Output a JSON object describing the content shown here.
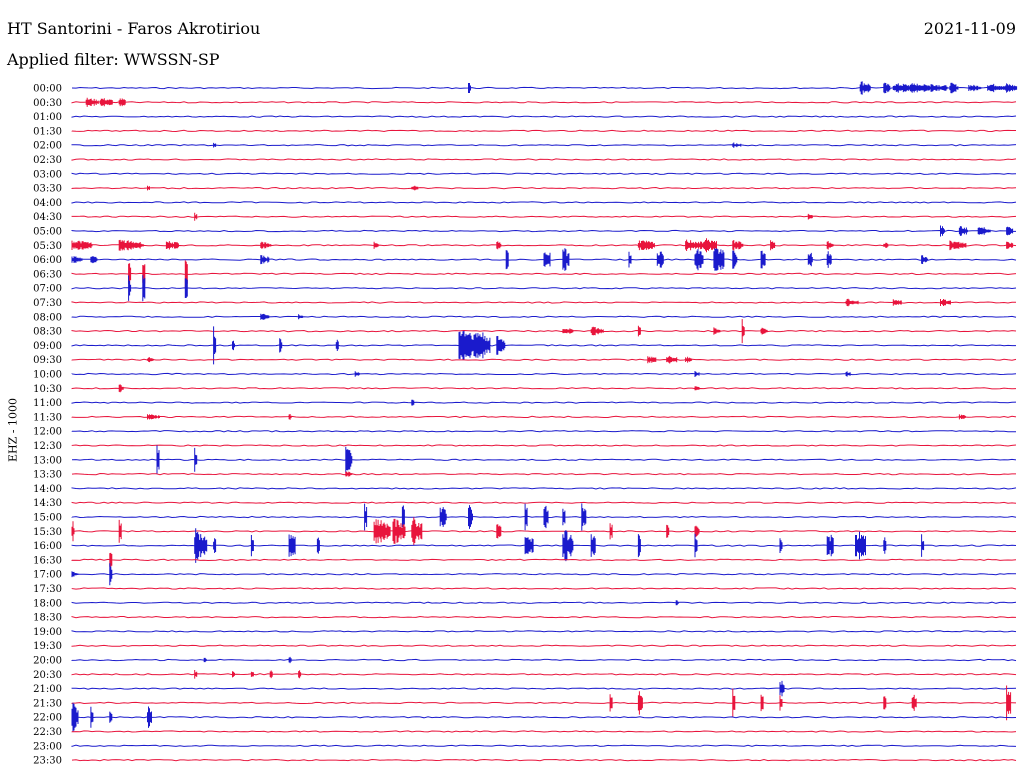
{
  "header": {
    "station": "HT Santorini - Faros Akrotiriou",
    "date": "2021-11-09",
    "filter": "Applied filter: WWSSN-SP",
    "channel": "EHZ - 1000"
  },
  "colors": {
    "blue": "#1a1acc",
    "red": "#e8143c"
  },
  "chart_data": {
    "type": "line",
    "title": "HT Santorini - Faros Akrotiriou",
    "date": "2021-11-09",
    "filter": "WWSSN-SP",
    "channel": "EHZ - 1000",
    "row_labels": [
      "00:00",
      "00:30",
      "01:00",
      "01:30",
      "02:00",
      "02:30",
      "03:00",
      "03:30",
      "04:00",
      "04:30",
      "05:00",
      "05:30",
      "06:00",
      "06:30",
      "07:00",
      "07:30",
      "08:00",
      "08:30",
      "09:00",
      "09:30",
      "10:00",
      "10:30",
      "11:00",
      "11:30",
      "12:00",
      "12:30",
      "13:00",
      "13:30",
      "14:00",
      "14:30",
      "15:00",
      "15:30",
      "16:00",
      "16:30",
      "17:00",
      "17:30",
      "18:00",
      "18:30",
      "19:00",
      "19:30",
      "20:00",
      "20:30",
      "21:00",
      "21:30",
      "22:00",
      "22:30",
      "23:00",
      "23:30"
    ],
    "row_minutes": 30,
    "row_colors": [
      "blue",
      "red"
    ],
    "events": {
      "00:00": [
        [
          0.42,
          10,
          1
        ],
        [
          0.835,
          8,
          5
        ],
        [
          0.86,
          6,
          3
        ],
        [
          0.87,
          5,
          18
        ],
        [
          0.89,
          5,
          12
        ],
        [
          0.91,
          5,
          8
        ],
        [
          0.93,
          6,
          4
        ],
        [
          0.95,
          4,
          6
        ],
        [
          0.97,
          5,
          10
        ],
        [
          0.99,
          5,
          5
        ]
      ],
      "00:30": [
        [
          0.015,
          5,
          6
        ],
        [
          0.03,
          5,
          6
        ],
        [
          0.05,
          5,
          3
        ]
      ],
      "02:00": [
        [
          0.15,
          3,
          1
        ],
        [
          0.7,
          3,
          4
        ]
      ],
      "03:30": [
        [
          0.08,
          3,
          1
        ],
        [
          0.36,
          3,
          3
        ]
      ],
      "04:30": [
        [
          0.13,
          5,
          1
        ],
        [
          0.78,
          3,
          2
        ]
      ],
      "05:00": [
        [
          0.92,
          6,
          2
        ],
        [
          0.94,
          6,
          4
        ],
        [
          0.96,
          5,
          6
        ],
        [
          0.99,
          5,
          3
        ]
      ],
      "05:30": [
        [
          0.0,
          6,
          10
        ],
        [
          0.05,
          6,
          12
        ],
        [
          0.1,
          5,
          6
        ],
        [
          0.2,
          4,
          5
        ],
        [
          0.32,
          4,
          2
        ],
        [
          0.45,
          5,
          2
        ],
        [
          0.6,
          6,
          8
        ],
        [
          0.65,
          6,
          10
        ],
        [
          0.67,
          8,
          6
        ],
        [
          0.7,
          6,
          5
        ],
        [
          0.74,
          5,
          2
        ],
        [
          0.8,
          5,
          3
        ],
        [
          0.86,
          4,
          2
        ],
        [
          0.93,
          5,
          8
        ],
        [
          0.99,
          5,
          3
        ]
      ],
      "06:00": [
        [
          0.0,
          4,
          5
        ],
        [
          0.02,
          5,
          3
        ],
        [
          0.2,
          5,
          4
        ],
        [
          0.46,
          12,
          1
        ],
        [
          0.5,
          12,
          3
        ],
        [
          0.52,
          14,
          3
        ],
        [
          0.59,
          12,
          1
        ],
        [
          0.62,
          12,
          3
        ],
        [
          0.66,
          14,
          4
        ],
        [
          0.68,
          16,
          5
        ],
        [
          0.7,
          12,
          2
        ],
        [
          0.73,
          10,
          2
        ],
        [
          0.78,
          10,
          2
        ],
        [
          0.8,
          10,
          2
        ],
        [
          0.9,
          5,
          3
        ]
      ],
      "06:30": [
        [
          0.06,
          14,
          1
        ],
        [
          0.075,
          16,
          1
        ],
        [
          0.12,
          18,
          1
        ]
      ],
      "07:00": [
        [
          0.06,
          14,
          1
        ],
        [
          0.075,
          16,
          1
        ],
        [
          0.12,
          18,
          1
        ]
      ],
      "07:30": [
        [
          0.82,
          4,
          6
        ],
        [
          0.87,
          4,
          4
        ],
        [
          0.92,
          4,
          5
        ]
      ],
      "08:00": [
        [
          0.2,
          4,
          4
        ],
        [
          0.24,
          3,
          2
        ]
      ],
      "08:30": [
        [
          0.52,
          4,
          5
        ],
        [
          0.55,
          5,
          6
        ],
        [
          0.6,
          6,
          1
        ],
        [
          0.68,
          4,
          3
        ],
        [
          0.71,
          12,
          1
        ],
        [
          0.73,
          4,
          3
        ]
      ],
      "09:00": [
        [
          0.15,
          20,
          1
        ],
        [
          0.17,
          8,
          1
        ],
        [
          0.22,
          8,
          1
        ],
        [
          0.28,
          8,
          1
        ],
        [
          0.41,
          20,
          12
        ],
        [
          0.43,
          16,
          6
        ],
        [
          0.45,
          10,
          4
        ]
      ],
      "09:30": [
        [
          0.08,
          3,
          3
        ],
        [
          0.61,
          4,
          4
        ],
        [
          0.63,
          5,
          5
        ],
        [
          0.65,
          4,
          3
        ]
      ],
      "10:00": [
        [
          0.3,
          3,
          2
        ],
        [
          0.66,
          3,
          2
        ],
        [
          0.82,
          3,
          2
        ]
      ],
      "10:30": [
        [
          0.05,
          5,
          2
        ],
        [
          0.66,
          3,
          2
        ]
      ],
      "11:00": [
        [
          0.36,
          5,
          1
        ]
      ],
      "11:30": [
        [
          0.08,
          3,
          6
        ],
        [
          0.23,
          4,
          1
        ],
        [
          0.94,
          3,
          3
        ]
      ],
      "13:00": [
        [
          0.09,
          18,
          1
        ],
        [
          0.13,
          12,
          1
        ],
        [
          0.29,
          14,
          3
        ]
      ],
      "13:30": [
        [
          0.29,
          4,
          3
        ]
      ],
      "15:00": [
        [
          0.31,
          16,
          1
        ],
        [
          0.35,
          14,
          1
        ],
        [
          0.39,
          14,
          3
        ],
        [
          0.42,
          16,
          2
        ],
        [
          0.48,
          14,
          1
        ],
        [
          0.5,
          14,
          2
        ],
        [
          0.52,
          12,
          1
        ],
        [
          0.54,
          14,
          2
        ]
      ],
      "15:30": [
        [
          0.0,
          12,
          1
        ],
        [
          0.05,
          12,
          1
        ],
        [
          0.32,
          14,
          8
        ],
        [
          0.34,
          14,
          6
        ],
        [
          0.36,
          16,
          5
        ],
        [
          0.45,
          10,
          2
        ],
        [
          0.57,
          10,
          1
        ],
        [
          0.63,
          14,
          1
        ],
        [
          0.66,
          10,
          2
        ]
      ],
      "16:00": [
        [
          0.13,
          18,
          6
        ],
        [
          0.15,
          10,
          1
        ],
        [
          0.19,
          12,
          1
        ],
        [
          0.23,
          18,
          3
        ],
        [
          0.26,
          14,
          1
        ],
        [
          0.48,
          14,
          4
        ],
        [
          0.52,
          18,
          5
        ],
        [
          0.55,
          14,
          2
        ],
        [
          0.6,
          12,
          1
        ],
        [
          0.66,
          14,
          1
        ],
        [
          0.75,
          12,
          1
        ],
        [
          0.8,
          16,
          3
        ],
        [
          0.83,
          18,
          5
        ],
        [
          0.86,
          12,
          1
        ],
        [
          0.9,
          14,
          1
        ]
      ],
      "16:30": [
        [
          0.04,
          10,
          1
        ]
      ],
      "17:00": [
        [
          0.0,
          3,
          3
        ],
        [
          0.04,
          16,
          1
        ]
      ],
      "18:00": [
        [
          0.64,
          3,
          1
        ]
      ],
      "20:00": [
        [
          0.14,
          3,
          1
        ],
        [
          0.23,
          4,
          1
        ]
      ],
      "20:30": [
        [
          0.13,
          5,
          1
        ],
        [
          0.17,
          5,
          1
        ],
        [
          0.19,
          4,
          1
        ],
        [
          0.21,
          5,
          1
        ],
        [
          0.24,
          5,
          1
        ]
      ],
      "21:00": [
        [
          0.75,
          12,
          2
        ]
      ],
      "21:30": [
        [
          0.57,
          16,
          1
        ],
        [
          0.6,
          18,
          2
        ],
        [
          0.7,
          16,
          1
        ],
        [
          0.73,
          12,
          1
        ],
        [
          0.75,
          10,
          1
        ],
        [
          0.86,
          8,
          1
        ],
        [
          0.89,
          14,
          2
        ],
        [
          0.99,
          18,
          2
        ]
      ],
      "22:00": [
        [
          0.0,
          18,
          3
        ],
        [
          0.02,
          14,
          1
        ],
        [
          0.04,
          10,
          1
        ],
        [
          0.08,
          12,
          2
        ]
      ]
    }
  }
}
